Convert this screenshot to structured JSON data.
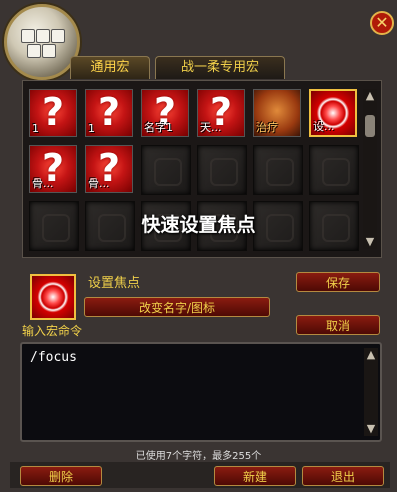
{
  "window": {
    "close_glyph": "✕"
  },
  "tabs": [
    {
      "label": "通用宏",
      "active": true
    },
    {
      "label": "战一柔专用宏",
      "active": false
    }
  ],
  "macros": [
    {
      "icon": "question-mark-icon",
      "label": "1"
    },
    {
      "icon": "question-mark-icon",
      "label": "1"
    },
    {
      "icon": "question-mark-icon",
      "label": "名字1"
    },
    {
      "icon": "question-mark-icon",
      "label": "天..."
    },
    {
      "icon": "heal-icon",
      "label": "治疗"
    },
    {
      "icon": "focus-target-icon",
      "label": "设..."
    },
    {
      "icon": "question-mark-icon",
      "label": "骨..."
    },
    {
      "icon": "question-mark-icon",
      "label": "骨..."
    }
  ],
  "overlay_caption": "快速设置焦点",
  "selected": {
    "name": "设置焦点",
    "change_name_button": "改变名字/图标",
    "icon": "focus-target-icon"
  },
  "buttons": {
    "save": "保存",
    "cancel": "取消",
    "delete": "删除",
    "new": "新建",
    "exit": "退出"
  },
  "editor": {
    "label": "输入宏命令",
    "text": "/focus",
    "char_count": "已使用7个字符，最多255个"
  },
  "colors": {
    "gold_text": "#f0d04a",
    "button_red": "#8a1c10",
    "frame_gold": "#b48a40"
  }
}
